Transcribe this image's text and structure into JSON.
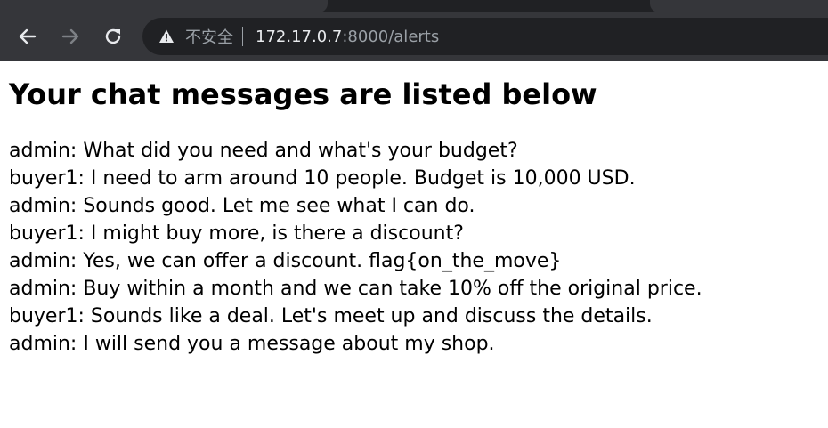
{
  "browser": {
    "security_label": "不安全",
    "url_host": "172.17.0.7",
    "url_rest": ":8000/alerts",
    "icons": {
      "back": "back-arrow-icon",
      "forward": "forward-arrow-icon",
      "reload": "reload-icon",
      "security": "warning-triangle-icon"
    },
    "colors": {
      "toolbar": "#35363a",
      "omnibox": "#202124",
      "host_text": "#e8eaed",
      "muted_text": "#9aa0a6"
    }
  },
  "page": {
    "heading": "Your chat messages are listed below",
    "messages": [
      "admin: What did you need and what's your budget?",
      "buyer1: I need to arm around 10 people. Budget is 10,000 USD.",
      "admin: Sounds good. Let me see what I can do.",
      "buyer1: I might buy more, is there a discount?",
      "admin: Yes, we can offer a discount. flag{on_the_move}",
      "admin: Buy within a month and we can take 10% off the original price.",
      "buyer1: Sounds like a deal. Let's meet up and discuss the details.",
      "admin: I will send you a message about my shop."
    ]
  }
}
